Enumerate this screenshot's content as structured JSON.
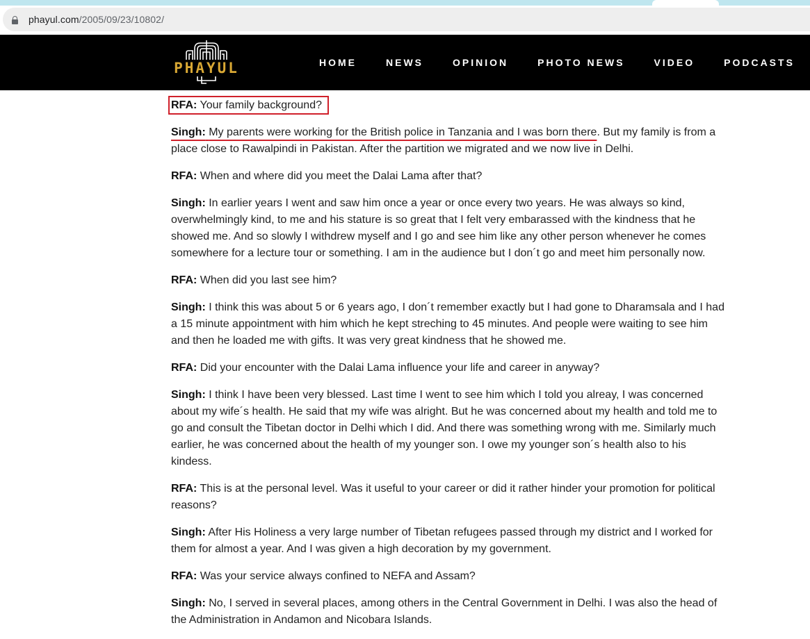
{
  "browser": {
    "url_host": "phayul.com",
    "url_path": "/2005/09/23/10802/",
    "lock_icon": "lock-icon"
  },
  "header": {
    "logo_text": "PHAYUL",
    "logo_color": "#d9a834",
    "nav": [
      {
        "label": "HOME"
      },
      {
        "label": "NEWS"
      },
      {
        "label": "OPINION"
      },
      {
        "label": "PHOTO NEWS"
      },
      {
        "label": "VIDEO"
      },
      {
        "label": "PODCASTS"
      }
    ]
  },
  "annotation_color": "#d0202a",
  "article": {
    "paragraphs": [
      {
        "speaker": "RFA:",
        "text": "Your family background?",
        "annotation": "box"
      },
      {
        "speaker": "Singh:",
        "underlined": "My parents were working for the British police in Tanzania and I was born there",
        "text": ". But my family is from a place close to Rawalpindi in Pakistan. After the partition we migrated and we now live in Delhi.",
        "annotation": "underline"
      },
      {
        "speaker": "RFA:",
        "text": "When and where did you meet the Dalai Lama after that?"
      },
      {
        "speaker": "Singh:",
        "text": "In earlier years I went and saw him once a year or once every two years. He was always so kind, overwhelmingly kind, to me and his stature is so great that I felt very embarassed with the kindness that he showed me. And so slowly I withdrew myself and I go and see him like any other person whenever he comes somewhere for a lecture tour or something. I am in the audience but I don´t go and meet him personally now."
      },
      {
        "speaker": "RFA:",
        "text": "When did you last see him?"
      },
      {
        "speaker": "Singh:",
        "text": "I think this was about 5 or 6 years ago, I don´t remember exactly but I had gone to Dharamsala and I had a 15 minute appointment with him which he kept streching to 45 minutes. And people were waiting to see him and then he loaded me with gifts. It was very great kindness that he showed me."
      },
      {
        "speaker": "RFA:",
        "text": "Did your encounter with the Dalai Lama influence your life and career in anyway?"
      },
      {
        "speaker": "Singh:",
        "text": "I think I have been very blessed. Last time I went to see him which I told you alreay, I was concerned about my wife´s health. He said that my wife was alright. But he was concerned about my health and told me to go and consult the Tibetan doctor in Delhi which I did. And there was something wrong with me. Similarly much earlier, he was concerned about the health of my younger son. I owe my younger son´s health also to his kindess."
      },
      {
        "speaker": "RFA:",
        "text": "This is at the personal level. Was it useful to your career or did it rather hinder your promotion for political reasons?"
      },
      {
        "speaker": "Singh:",
        "text": "After His Holiness a very large number of Tibetan refugees passed through my district and I worked for them for almost a year. And I was given a high decoration by my government."
      },
      {
        "speaker": "RFA:",
        "text": "Was your service always confined to NEFA and Assam?"
      },
      {
        "speaker": "Singh:",
        "text": "No, I served in several places, among others in the Central Government in Delhi. I was also the head of the Administration in Andamon and Nicobara Islands."
      }
    ]
  }
}
